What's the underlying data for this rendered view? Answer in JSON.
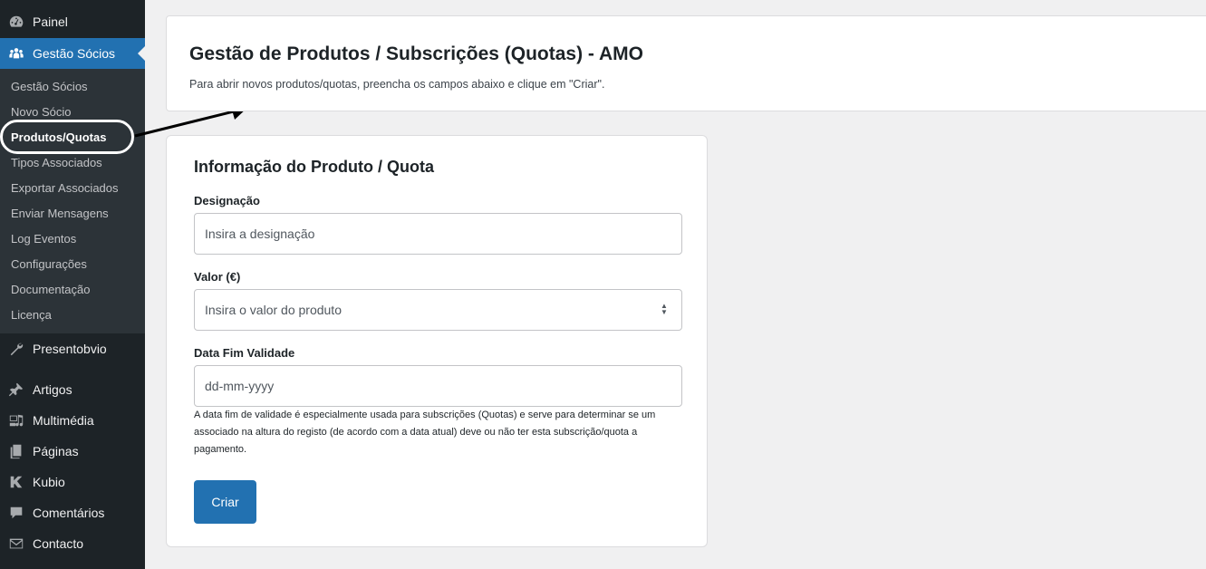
{
  "sidebar": {
    "top_items": [
      {
        "label": "Painel",
        "icon": "dashboard-icon"
      },
      {
        "label": "Gestão Sócios",
        "icon": "groups-icon",
        "active": true
      },
      {
        "label": "Presentobvio",
        "icon": "wrench-icon"
      },
      {
        "label": "Artigos",
        "icon": "pin-icon"
      },
      {
        "label": "Multimédia",
        "icon": "media-icon"
      },
      {
        "label": "Páginas",
        "icon": "pages-icon"
      },
      {
        "label": "Kubio",
        "icon": "kubio-icon"
      },
      {
        "label": "Comentários",
        "icon": "comment-icon"
      },
      {
        "label": "Contacto",
        "icon": "mail-icon"
      }
    ],
    "submenu": [
      "Gestão Sócios",
      "Novo Sócio",
      "Produtos/Quotas",
      "Tipos Associados",
      "Exportar Associados",
      "Enviar Mensagens",
      "Log Eventos",
      "Configurações",
      "Documentação",
      "Licença"
    ],
    "current_submenu": "Produtos/Quotas"
  },
  "header": {
    "title": "Gestão de Produtos / Subscrições (Quotas) - AMO",
    "description": "Para abrir novos produtos/quotas, preencha os campos abaixo e clique em \"Criar\"."
  },
  "form": {
    "title": "Informação do Produto / Quota",
    "designacao": {
      "label": "Designação",
      "placeholder": "Insira a designação",
      "value": ""
    },
    "valor": {
      "label": "Valor (€)",
      "placeholder": "Insira o valor do produto",
      "value": ""
    },
    "data_fim": {
      "label": "Data Fim Validade",
      "placeholder": "dd-mm-yyyy",
      "value": ""
    },
    "help_text": "A data fim de validade é especialmente usada para subscrições (Quotas) e serve para determinar se um associado na altura do registo (de acordo com a data atual) deve ou não ter esta subscrição/quota a pagamento.",
    "submit_label": "Criar"
  },
  "colors": {
    "sidebar_bg": "#1d2327",
    "submenu_bg": "#2c3338",
    "accent": "#2271b1",
    "page_bg": "#f0f0f1"
  }
}
